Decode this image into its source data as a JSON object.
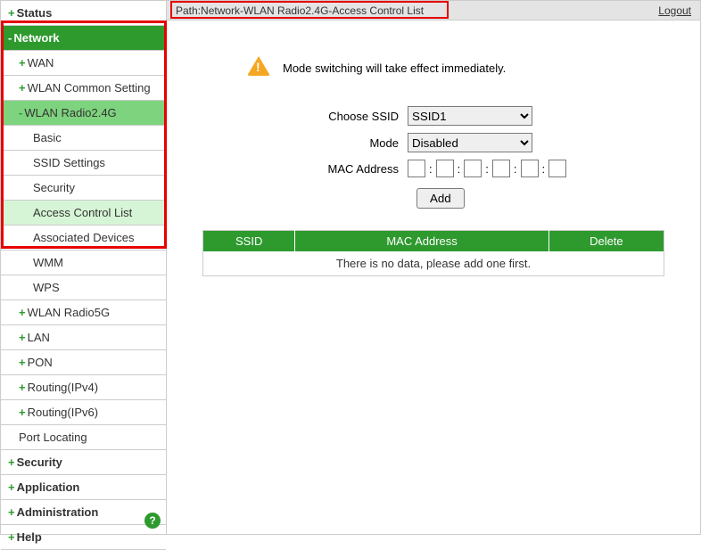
{
  "sidebar": {
    "items": [
      {
        "toggle": "+",
        "label": "Status"
      },
      {
        "toggle": "-",
        "label": "Network",
        "expanded": true
      },
      {
        "toggle": "+",
        "label": "WAN"
      },
      {
        "toggle": "+",
        "label": "WLAN Common Setting"
      },
      {
        "toggle": "-",
        "label": "WLAN Radio2.4G",
        "active": true
      },
      {
        "label": "Basic"
      },
      {
        "label": "SSID Settings"
      },
      {
        "label": "Security"
      },
      {
        "label": "Access Control List",
        "active": true
      },
      {
        "label": "Associated Devices"
      },
      {
        "label": "WMM"
      },
      {
        "label": "WPS"
      },
      {
        "toggle": "+",
        "label": "WLAN Radio5G"
      },
      {
        "toggle": "+",
        "label": "LAN"
      },
      {
        "toggle": "+",
        "label": "PON"
      },
      {
        "toggle": "+",
        "label": "Routing(IPv4)"
      },
      {
        "toggle": "+",
        "label": "Routing(IPv6)"
      },
      {
        "label": "Port Locating"
      },
      {
        "toggle": "+",
        "label": "Security"
      },
      {
        "toggle": "+",
        "label": "Application"
      },
      {
        "toggle": "+",
        "label": "Administration"
      },
      {
        "toggle": "+",
        "label": "Help"
      }
    ]
  },
  "topbar": {
    "path_prefix": "Path:",
    "path_value": "Network-WLAN Radio2.4G-Access Control List",
    "logout": "Logout"
  },
  "alert": {
    "text": "Mode switching will take effect immediately."
  },
  "form": {
    "ssid_label": "Choose SSID",
    "ssid_value": "SSID1",
    "mode_label": "Mode",
    "mode_value": "Disabled",
    "mac_label": "MAC Address",
    "mac_sep": ":",
    "add_label": "Add"
  },
  "table": {
    "headers": [
      "SSID",
      "MAC Address",
      "Delete"
    ],
    "empty": "There is no data, please add one first."
  },
  "help": "?"
}
